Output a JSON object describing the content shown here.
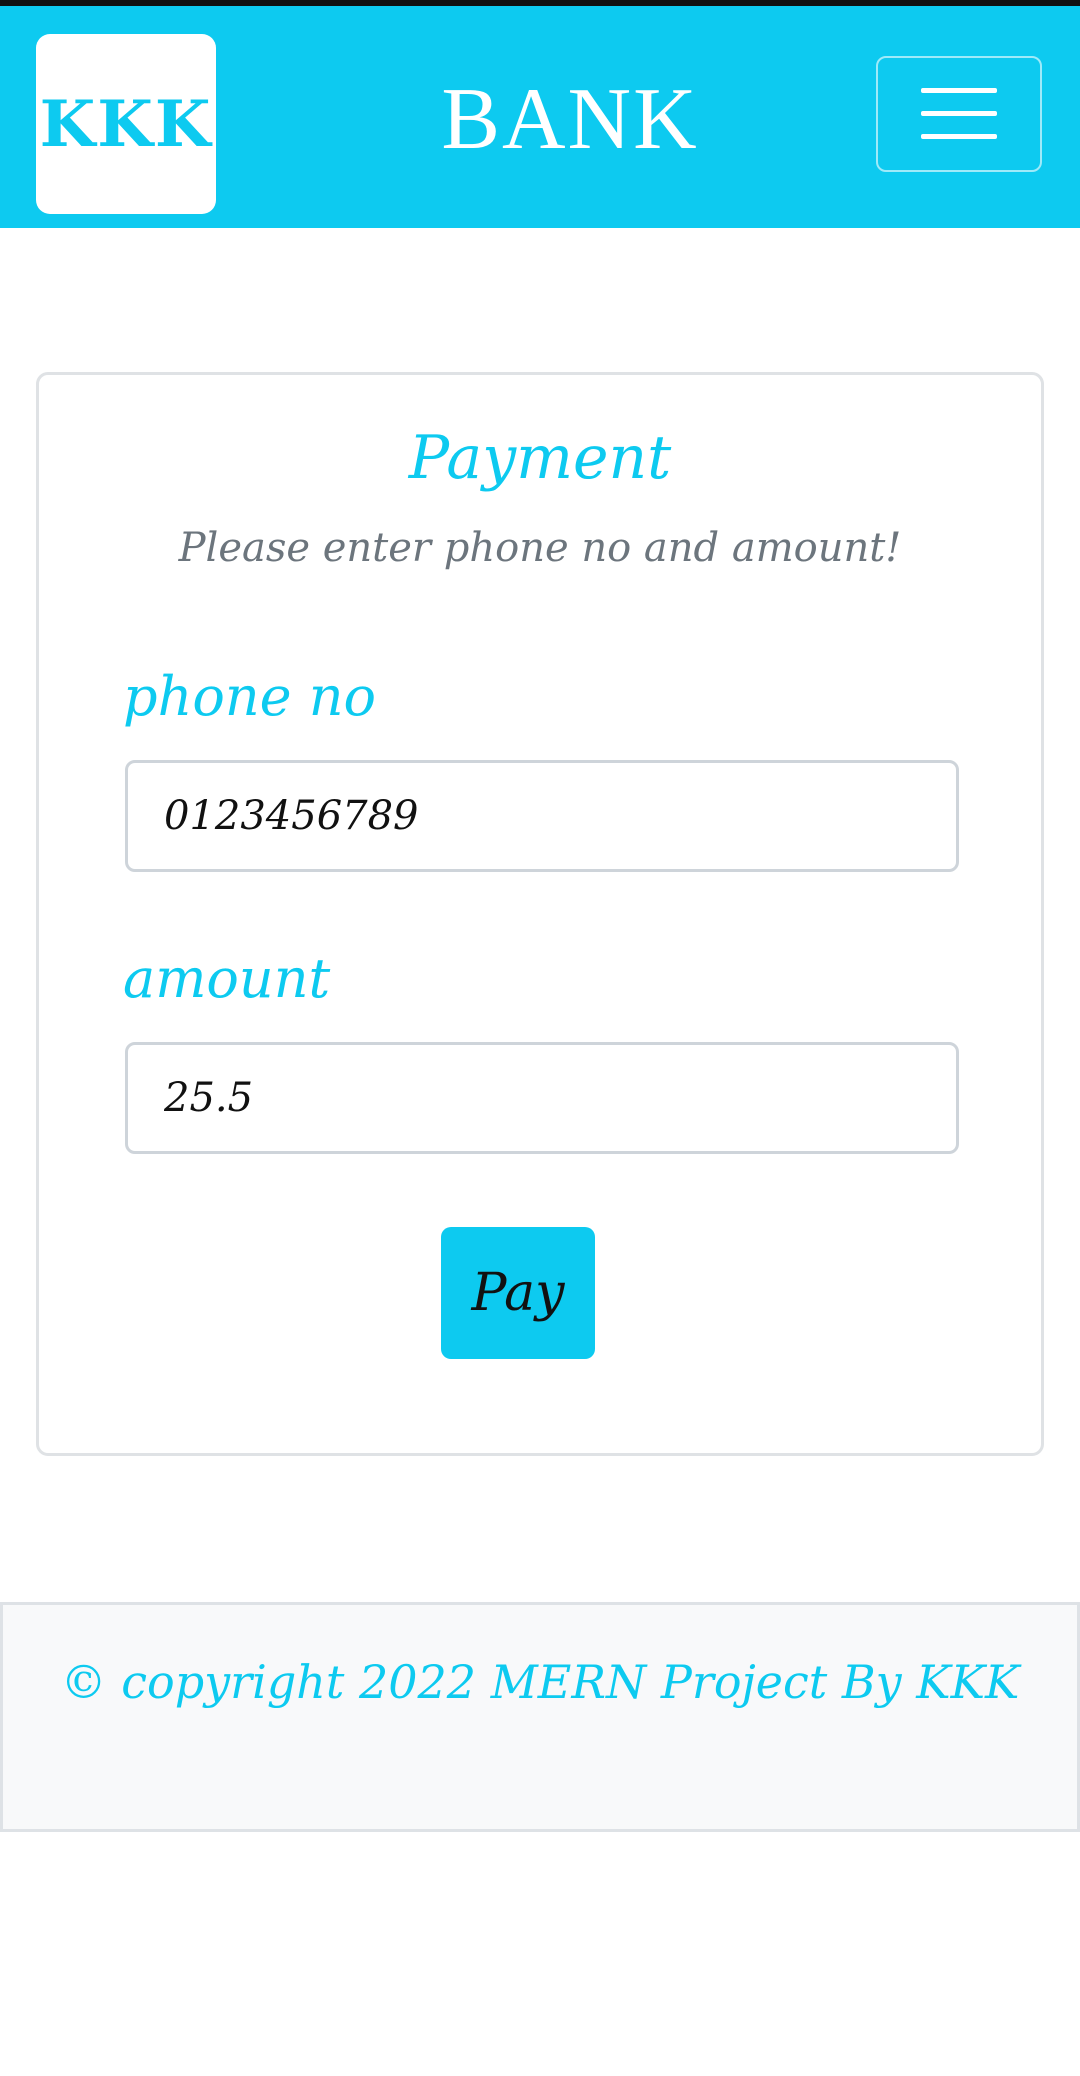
{
  "navbar": {
    "logo_text": "KKK",
    "brand": "BANK",
    "menu_icon": "hamburger-icon"
  },
  "payment": {
    "title": "Payment",
    "subtitle": "Please enter phone no and amount!",
    "phone": {
      "label": "phone no",
      "value": "0123456789"
    },
    "amount": {
      "label": "amount",
      "value": "25.5"
    },
    "pay_label": "Pay"
  },
  "footer": {
    "text": "© copyright 2022 MERN Project By KKK"
  },
  "colors": {
    "accent": "#0dcaf0",
    "muted_text": "#6c757d",
    "border": "#dfe2e5",
    "footer_bg": "#f8f9fa"
  }
}
